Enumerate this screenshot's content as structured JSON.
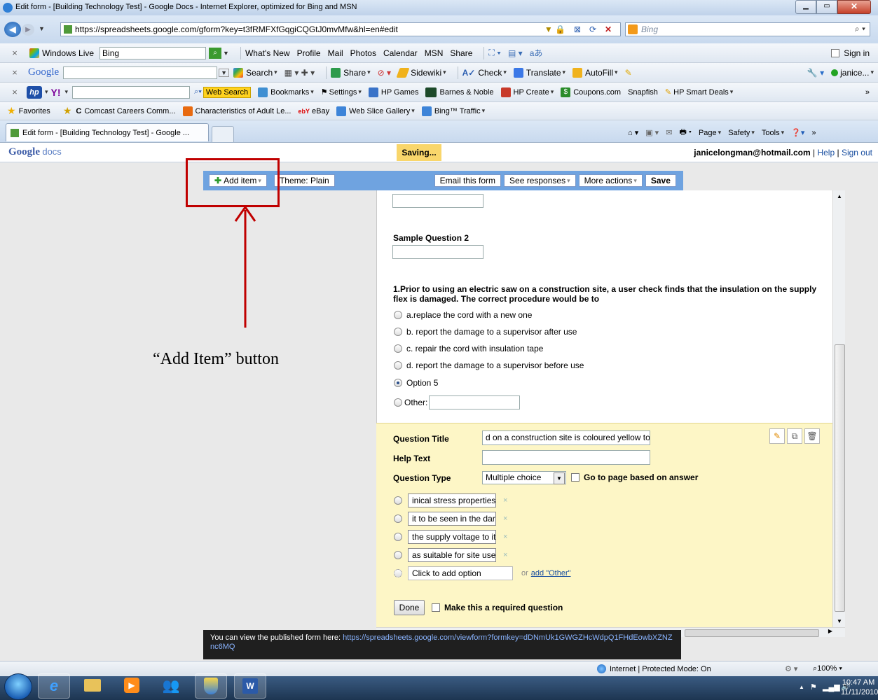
{
  "window": {
    "title": "Edit form - [Building Technology Test] - Google Docs - Internet Explorer, optimized for Bing and MSN"
  },
  "addressbar": {
    "url": "https://spreadsheets.google.com/gform?key=t3fRMFXfGqgiCQGtJ0mvMfw&hl=en#edit",
    "search_engine": "Bing"
  },
  "toolbar_live": {
    "brand": "Windows Live",
    "search_value": "Bing",
    "links": [
      "What's New",
      "Profile",
      "Mail",
      "Photos",
      "Calendar",
      "MSN",
      "Share"
    ],
    "signin": "Sign in"
  },
  "toolbar_google": {
    "brand": "Google",
    "items": [
      "Search",
      "Share",
      "Sidewiki",
      "Check",
      "Translate",
      "AutoFill"
    ],
    "account": "janice..."
  },
  "toolbar_yahoo": {
    "items": [
      "Web Search",
      "Bookmarks",
      "Settings",
      "HP Games",
      "Barnes & Noble",
      "HP Create",
      "Coupons.com",
      "Snapfish",
      "HP Smart Deals"
    ]
  },
  "favorites": {
    "label": "Favorites",
    "items": [
      "Comcast Careers Comm...",
      "Characteristics of Adult Le...",
      "eBay",
      "Web Slice Gallery",
      "Bing™ Traffic"
    ]
  },
  "tab": {
    "title": "Edit form - [Building Technology Test] - Google ...",
    "commands": [
      "Page",
      "Safety",
      "Tools"
    ]
  },
  "gdocs": {
    "logo_google": "Google",
    "logo_docs": "docs",
    "status": "Saving...",
    "email": "janicelongman@hotmail.com",
    "help": "Help",
    "sep": "|",
    "signout": "Sign out"
  },
  "formbar": {
    "add_item": "Add item",
    "theme": "Theme: Plain",
    "email_form": "Email this form",
    "see_responses": "See responses",
    "more_actions": "More actions",
    "save": "Save"
  },
  "annotation": {
    "label": "“Add Item” button"
  },
  "form": {
    "q2_title": "Sample Question 2",
    "q1_title": "1.Prior to using an electric saw on a construction site, a user check finds that the insulation on the supply flex is damaged. The correct procedure would be to",
    "q1_options": [
      "a.replace the cord with a new one",
      "b. report the damage to a supervisor after use",
      "c. repair the cord with insulation tape",
      "d. report the damage to a supervisor before use",
      "Option 5"
    ],
    "other_label": "Other:"
  },
  "editor": {
    "question_title_label": "Question Title",
    "question_title_value": "d on a construction site is coloured yellow to",
    "help_text_label": "Help Text",
    "question_type_label": "Question Type",
    "question_type_value": "Multiple choice",
    "goto_page_label": "Go to page based on answer",
    "options": [
      "inical stress properties",
      "it to be seen in the dark",
      "the supply voltage to it",
      "as suitable for site use"
    ],
    "remove_glyph": "×",
    "add_option_placeholder": "Click to add option",
    "or_text": "or",
    "add_other": "add \"Other\"",
    "done": "Done",
    "required_label": "Make this a required question"
  },
  "tooltip": {
    "text": "You can view the published form here:",
    "link": "https://spreadsheets.google.com/viewform?formkey=dDNmUk1GWGZHcWdpQ1FHdEowbXZNZnc6MQ"
  },
  "statusbar": {
    "zone": "Internet | Protected Mode: On",
    "zoom": "100%"
  },
  "taskbar": {
    "time": "10:47 AM",
    "date": "11/11/2010"
  },
  "colors": {
    "form_bar_blue": "#6fa3e0",
    "editor_yellow": "#fdf6c6",
    "annotation_red": "#c00000",
    "saving_bg": "#f9d66b"
  }
}
